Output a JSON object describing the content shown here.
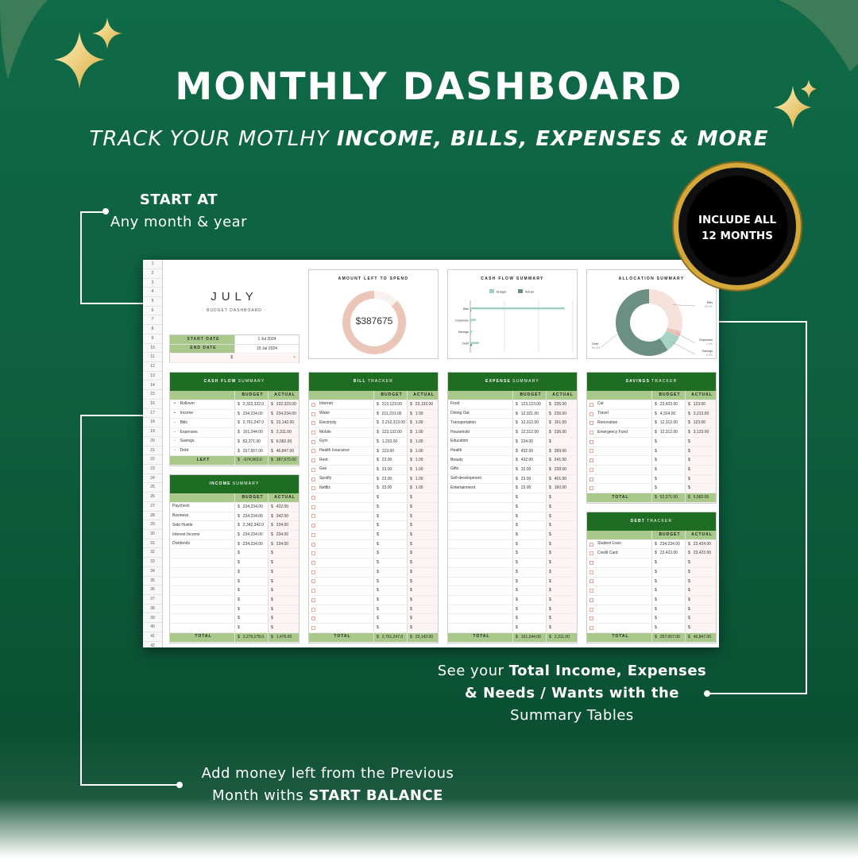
{
  "title": "MONTHLY DASHBOARD",
  "subtitle": {
    "light": "TRACK YOUR MOTLHY ",
    "bold": "INCOME, BILLS, EXPENSES & MORE"
  },
  "callouts": {
    "start": {
      "heading": "START AT",
      "text": "Any month & year"
    },
    "summary": {
      "l1a": "See your ",
      "l1b": "Total Income, Expenses",
      "l2": "& Needs / Wants with the",
      "l3": "Summary Tables"
    },
    "balance": {
      "l1": "Add money left from the Previous",
      "l2a": "Month withs ",
      "l2b": "START BALANCE"
    }
  },
  "badge": {
    "line1": "INCLUDE ALL",
    "line2": "12 MONTHS"
  },
  "colors": {
    "header_green": "#1f6d22",
    "sub_green": "#a8c98a",
    "peach": "#ebc6b8",
    "teal": "#9fcfc0",
    "dark_teal": "#6b8f82",
    "gold": "#d4a93a"
  },
  "sheet": {
    "row_labels": [
      "1",
      "2",
      "3",
      "4",
      "5",
      "6",
      "7",
      "8",
      "9",
      "10",
      "11",
      "12",
      "13",
      "14",
      "15",
      "16",
      "17",
      "18",
      "19",
      "20",
      "21",
      "22",
      "23",
      "24",
      "25",
      "26",
      "27",
      "28",
      "29",
      "30",
      "31",
      "32",
      "33",
      "34",
      "35",
      "36",
      "37",
      "38",
      "39",
      "40",
      "41",
      "42"
    ],
    "month": "JULY",
    "dashboard_label": "· BUDGET DASHBOARD ·",
    "start_date_label": "START DATE",
    "start_date": "1 Jul 2024",
    "end_date_label": "END DATE",
    "end_date": "15 Jul 2024",
    "currency_symbol": "$",
    "col_budget": "BUDGET",
    "col_actual": "ACTUAL",
    "amount_left": {
      "title": "AMOUNT LEFT TO SPEND",
      "value": "$387675",
      "filled_fraction": 0.87
    },
    "cash_flow_chart": {
      "title": "CASH FLOW SUMMARY",
      "legend": [
        "Budget",
        "Actual"
      ],
      "chart_data": {
        "type": "bar",
        "orientation": "horizontal",
        "categories": [
          "Bills",
          "Expenses",
          "Savings",
          "Debt"
        ],
        "series": [
          {
            "name": "Budget",
            "values": [
              2761247,
              161244,
              52371,
              257657
            ],
            "color": "#9fcfc0"
          },
          {
            "name": "Actual",
            "values": [
              23142,
              2311,
              6582,
              46847
            ],
            "color": "#6b8f82"
          }
        ],
        "xlim": [
          0,
          3000000
        ],
        "grid": true,
        "legend": "top"
      }
    },
    "allocation_chart": {
      "title": "ALLOCATION SUMMARY",
      "chart_data": {
        "type": "pie",
        "donut": true,
        "labels": [
          "Bills",
          "Expenses",
          "Savings",
          "Debt"
        ],
        "values": [
          29.3,
          2.9,
          8.3,
          59.4
        ],
        "value_labels": [
          "29.3%",
          "2.9%",
          "8.3%",
          "59.4%"
        ],
        "colors": [
          "#f6e1db",
          "#ebc2b4",
          "#a6d3c6",
          "#6b8f82"
        ]
      }
    },
    "tables": {
      "cashflow": {
        "bold": "CASH FLOW",
        "light": "SUMMARY",
        "rows": [
          {
            "m": "•",
            "l": "Rollover",
            "b": "2,323,322.0",
            "a": "232,323.00"
          },
          {
            "m": "•",
            "l": "Income",
            "b": "234,234.00",
            "a": "234,234.00"
          },
          {
            "m": "-",
            "l": "Bills",
            "b": "2,761,247.0",
            "a": "23,142.00"
          },
          {
            "m": "-",
            "l": "Expenses",
            "b": "161,244.00",
            "a": "2,311.00"
          },
          {
            "m": "-",
            "l": "Savings",
            "b": "52,371.00",
            "a": "6,582.00"
          },
          {
            "m": "-",
            "l": "Debt",
            "b": "257,657.00",
            "a": "46,847.00"
          }
        ],
        "total": {
          "l": "LEFT",
          "b": "-674,963.0",
          "a": "387,675.00"
        }
      },
      "income": {
        "bold": "INCOME",
        "light": "SUMMARY",
        "rows": [
          {
            "l": "Paycheck",
            "b": "234,234.00",
            "a": "432.00"
          },
          {
            "l": "Business",
            "b": "234,234.00",
            "a": "342.00"
          },
          {
            "l": "Side Hustle",
            "b": "2,342,342.0",
            "a": "234.00"
          },
          {
            "l": "Interest Income",
            "b": "234,234.00",
            "a": "234.00"
          },
          {
            "l": "Dividends",
            "b": "234,234.00",
            "a": "234.00"
          }
        ],
        "total": {
          "l": "TOTAL",
          "b": "3,279,278.0",
          "a": "1,476.00"
        }
      },
      "bill": {
        "bold": "BILL",
        "light": "TRACKER",
        "rows": [
          {
            "l": "Internet",
            "b": "213,123.00",
            "a": "23,133.00"
          },
          {
            "l": "Water",
            "b": "211,231.00",
            "a": "1.00"
          },
          {
            "l": "Electricity",
            "b": "2,212,313.00",
            "a": "1.00"
          },
          {
            "l": "Mobile",
            "b": "123,132.00",
            "a": "1.00"
          },
          {
            "l": "Gym",
            "b": "1,233.00",
            "a": "1.00"
          },
          {
            "l": "Health Insurance",
            "b": "123.00",
            "a": "1.00"
          },
          {
            "l": "Rent",
            "b": "23.00",
            "a": "1.00"
          },
          {
            "l": "Gas",
            "b": "23.00",
            "a": "1.00"
          },
          {
            "l": "Spotify",
            "b": "23.00",
            "a": "1.00"
          },
          {
            "l": "Netflix",
            "b": "23.00",
            "a": "1.00"
          }
        ],
        "total": {
          "l": "TOTAL",
          "b": "2,761,247.0",
          "a": "23,142.00"
        }
      },
      "expense": {
        "bold": "EXPENSE",
        "light": "SUMMARY",
        "rows": [
          {
            "l": "Food",
            "b": "123,123.00",
            "a": "235.00"
          },
          {
            "l": "Dining Out",
            "b": "12,321.00",
            "a": "239.00"
          },
          {
            "l": "Transportation",
            "b": "12,312.00",
            "a": "161.00"
          },
          {
            "l": "Household",
            "b": "12,312.00",
            "a": "236.00"
          },
          {
            "l": "Education",
            "b": "234.00",
            "a": ""
          },
          {
            "l": "Health",
            "b": "432.00",
            "a": "399.00"
          },
          {
            "l": "Beauty",
            "b": "432.00",
            "a": "241.00"
          },
          {
            "l": "Gifts",
            "b": "32.00",
            "a": "239.00"
          },
          {
            "l": "Self-development",
            "b": "23.00",
            "a": "401.00"
          },
          {
            "l": "Entertainment",
            "b": "23.00",
            "a": "160.00"
          }
        ],
        "total": {
          "l": "TOTAL",
          "b": "161,244.00",
          "a": "2,311.00"
        }
      },
      "savings": {
        "bold": "SAVINGS",
        "light": "TRACKER",
        "rows": [
          {
            "l": "Car",
            "b": "23,423.00",
            "a": "123.00"
          },
          {
            "l": "Travel",
            "b": "4,324.00",
            "a": "3,213.00"
          },
          {
            "l": "Renovation",
            "b": "12,312.00",
            "a": "123.00"
          },
          {
            "l": "Emergency Fund",
            "b": "12,312.00",
            "a": "3,123.00"
          }
        ],
        "total": {
          "l": "TOTAL",
          "b": "52,371.00",
          "a": "6,582.00"
        }
      },
      "debt": {
        "bold": "DEBT",
        "light": "TRACKER",
        "rows": [
          {
            "l": "Student Loan",
            "b": "234,234.00",
            "a": "23,424.00"
          },
          {
            "l": "Credit Card",
            "b": "23,423.00",
            "a": "23,423.00"
          }
        ],
        "total": {
          "l": "TOTAL",
          "b": "257,657.00",
          "a": "46,847.00"
        }
      }
    }
  }
}
